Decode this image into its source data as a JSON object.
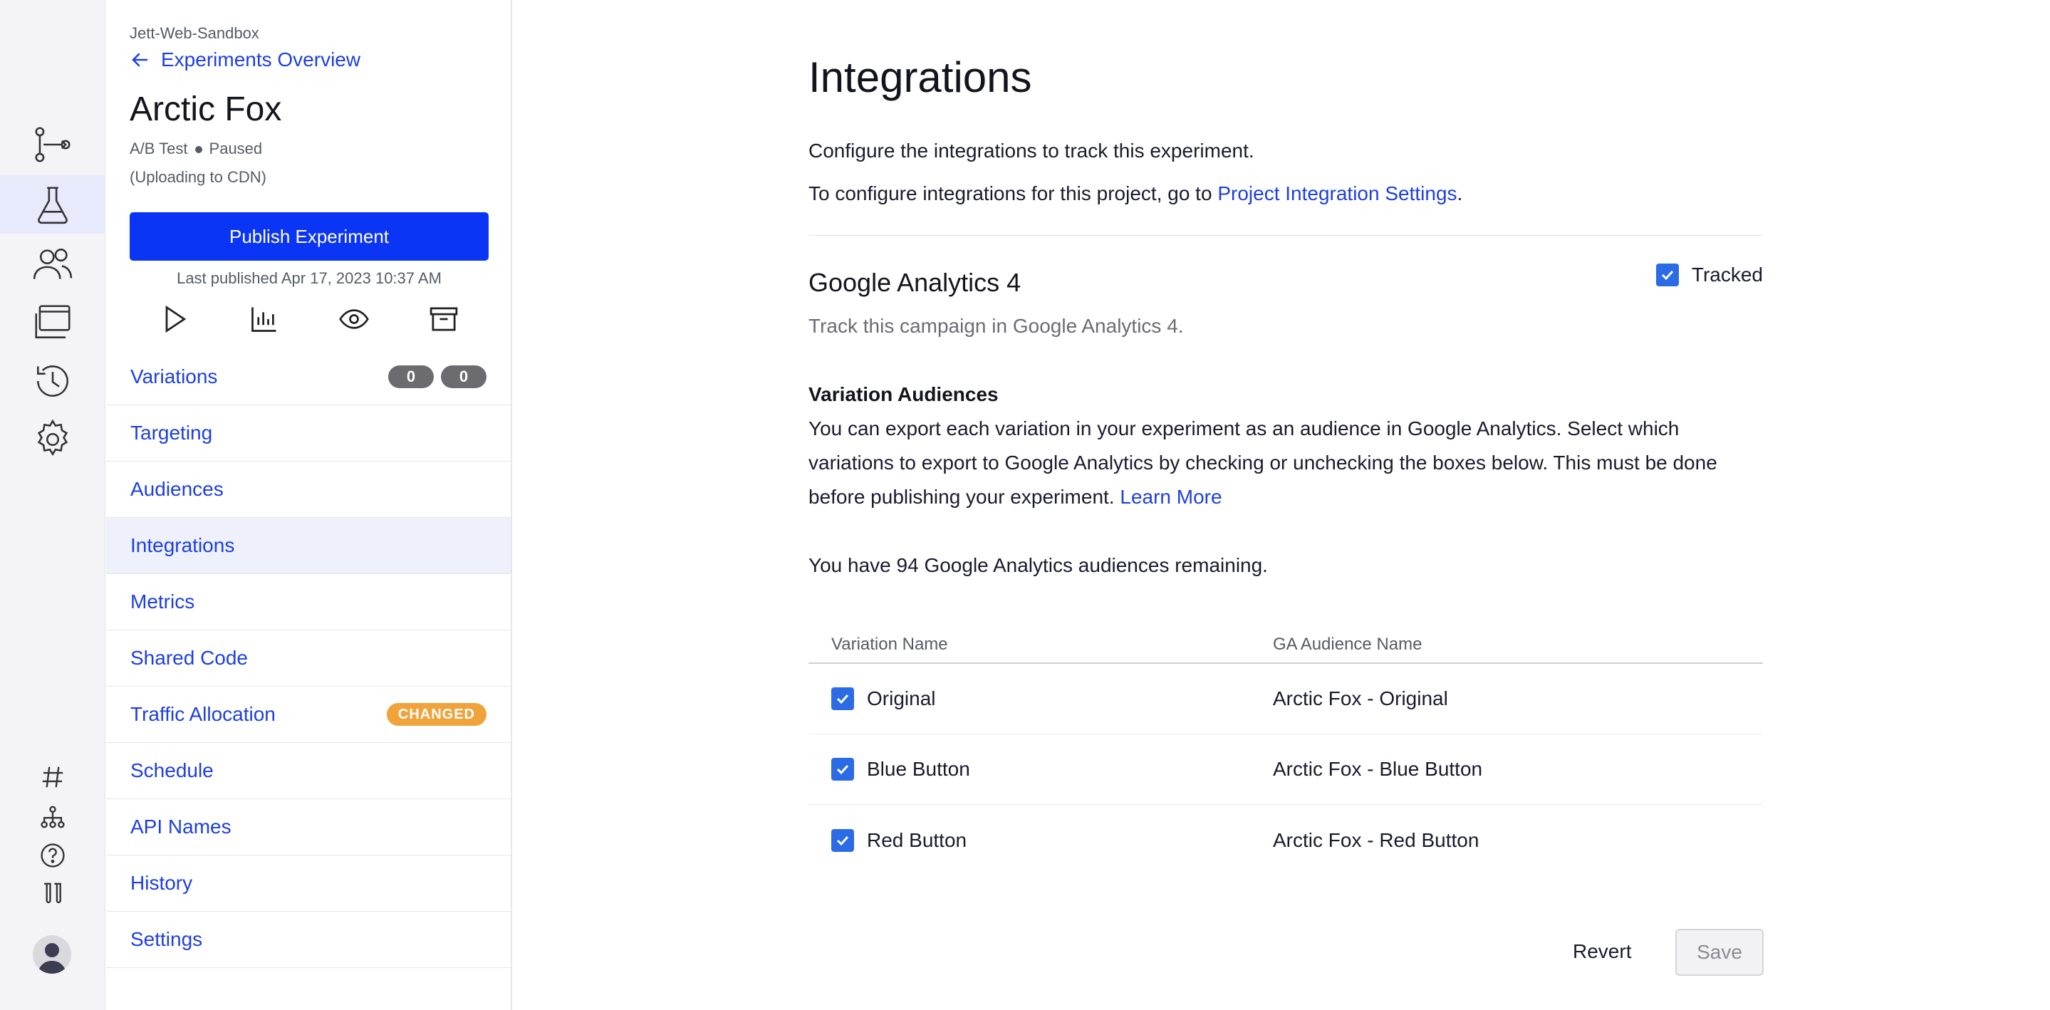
{
  "colors": {
    "accent": "#0b35f5",
    "link": "#1d3fe0",
    "changed": "#f0a33a",
    "checkbox": "#2c6be6"
  },
  "rail": {
    "items": [
      {
        "icon": "git-branch-icon"
      },
      {
        "icon": "flask-icon"
      },
      {
        "icon": "users-icon"
      },
      {
        "icon": "browser-windows-icon"
      },
      {
        "icon": "history-icon"
      },
      {
        "icon": "gear-icon"
      }
    ],
    "bottom": [
      {
        "icon": "hash-icon"
      },
      {
        "icon": "hierarchy-icon"
      },
      {
        "icon": "help-icon"
      },
      {
        "icon": "test-tubes-icon"
      }
    ],
    "avatar_icon": "user-avatar-icon"
  },
  "sidebar": {
    "project": "Jett-Web-Sandbox",
    "back_label": "Experiments Overview",
    "experiment_name": "Arctic Fox",
    "type": "A/B Test",
    "status": "Paused",
    "status_detail": "(Uploading to CDN)",
    "publish_label": "Publish Experiment",
    "last_published": "Last published Apr 17, 2023 10:37 AM",
    "actions": [
      {
        "icon": "play-icon"
      },
      {
        "icon": "bar-chart-icon"
      },
      {
        "icon": "eye-icon"
      },
      {
        "icon": "archive-icon"
      }
    ],
    "nav": [
      {
        "label": "Variations",
        "badges": [
          "0",
          "0"
        ]
      },
      {
        "label": "Targeting"
      },
      {
        "label": "Audiences"
      },
      {
        "label": "Integrations",
        "active": true
      },
      {
        "label": "Metrics"
      },
      {
        "label": "Shared Code"
      },
      {
        "label": "Traffic Allocation",
        "tag": "CHANGED"
      },
      {
        "label": "Schedule"
      },
      {
        "label": "API Names"
      },
      {
        "label": "History"
      },
      {
        "label": "Settings"
      }
    ]
  },
  "main": {
    "title": "Integrations",
    "intro": "Configure the integrations to track this experiment.",
    "project_prefix": "To configure integrations for this project, go to ",
    "project_link": "Project Integration Settings",
    "project_suffix": ".",
    "integration": {
      "name": "Google Analytics 4",
      "tracked_label": "Tracked",
      "tracked": true,
      "description": "Track this campaign in Google Analytics 4."
    },
    "audiences": {
      "heading": "Variation Audiences",
      "body": "You can export each variation in your experiment as an audience in Google Analytics. Select which variations to export to Google Analytics by checking or unchecking the boxes below. This must be done before publishing your experiment.",
      "learn_more": "Learn More",
      "remaining": "You have 94 Google Analytics audiences remaining."
    },
    "table": {
      "headers": [
        "Variation Name",
        "GA Audience Name"
      ],
      "rows": [
        {
          "variation": "Original",
          "audience": "Arctic Fox - Original",
          "checked": true
        },
        {
          "variation": "Blue Button",
          "audience": "Arctic Fox - Blue Button",
          "checked": true
        },
        {
          "variation": "Red Button",
          "audience": "Arctic Fox - Red Button",
          "checked": true
        }
      ]
    },
    "revert_label": "Revert",
    "save_label": "Save"
  }
}
